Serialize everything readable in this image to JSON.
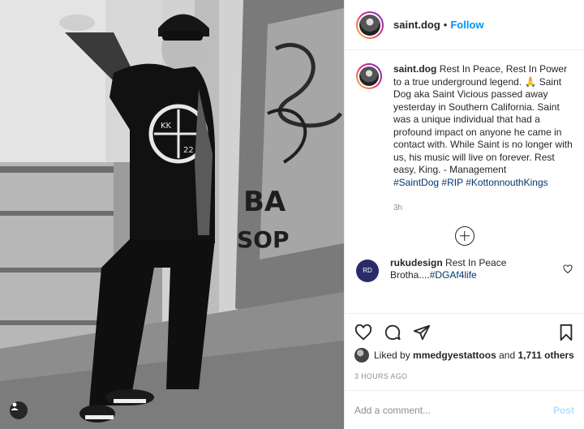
{
  "header": {
    "username": "saint.dog",
    "dot": "•",
    "follow_label": "Follow"
  },
  "caption": {
    "username": "saint.dog",
    "text": "Rest In Peace, Rest In Power to a true underground legend. 🙏 Saint Dog aka Saint Vicious passed away yesterday in Southern California. Saint was a unique individual that had a profound impact on anyone he came in contact with. While Saint is no longer with us, his music will live on forever. Rest easy, King. - Management",
    "hashtags": [
      "#SaintDog",
      "#RIP",
      "#KottonnouthKings"
    ],
    "age": "3h"
  },
  "comment": {
    "username": "rukudesign",
    "text": "Rest In Peace Brotha....",
    "hashtag": "#DGAf4life",
    "avatar_text": "RD"
  },
  "actions": {
    "like_icon": "heart-outline-icon",
    "comment_icon": "comment-bubble-icon",
    "share_icon": "paper-plane-icon",
    "save_icon": "bookmark-icon"
  },
  "likes": {
    "prefix": "Liked by",
    "user": "mmedgyestattoos",
    "middle": "and",
    "count": "1,711 others"
  },
  "timestamp": "3 HOURS AGO",
  "add_comment": {
    "placeholder": "Add a comment...",
    "post_label": "Post"
  },
  "photo": {
    "shirt_text_left": "KK",
    "shirt_text_right": "22",
    "wall_graffiti": "BA SOP"
  },
  "colors": {
    "link": "#0095f6",
    "hashtag": "#00376b",
    "muted": "#8e8e8e",
    "post_disabled": "#b2dffc"
  }
}
